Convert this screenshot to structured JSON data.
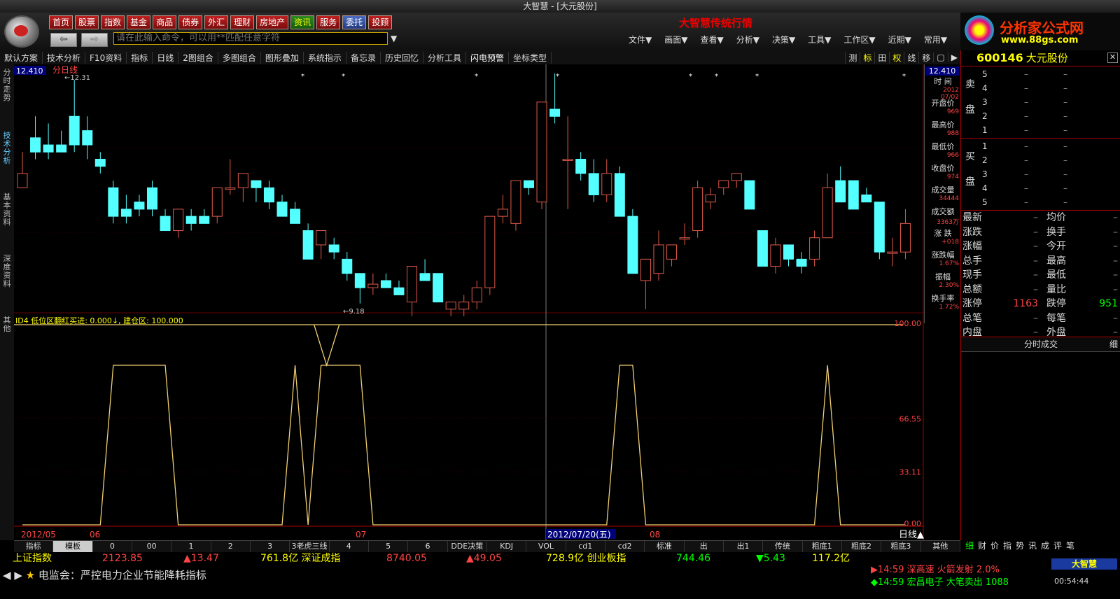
{
  "window_title": "大智慧 - [大元股份]",
  "nav": [
    "首页",
    "股票",
    "指数",
    "基金",
    "商品",
    "债券",
    "外汇",
    "理财",
    "房地产",
    "资讯",
    "服务",
    "委托",
    "投顾"
  ],
  "command_placeholder": "请在此输入命令，可以用**匹配任意字符",
  "slogan": "大智慧传统行情",
  "brand": {
    "name": "分析家公式网",
    "url": "www.88gs.com"
  },
  "menus": [
    "文件▼",
    "画面▼",
    "查看▼",
    "分析▼",
    "决策▼",
    "工具▼",
    "工作区▼",
    "近期▼",
    "常用▼"
  ],
  "toolbar": [
    "默认方案",
    "技术分析",
    "F10资料",
    "指标",
    "日线",
    "2图组合",
    "多图组合",
    "图形叠加",
    "系统指示",
    "备忘录",
    "历史回忆",
    "分析工具",
    "闪电预警",
    "坐标类型"
  ],
  "toolbar_right": [
    "测",
    "标",
    "田",
    "权",
    "线",
    "移",
    "▢",
    "▶"
  ],
  "left_tabs": [
    "分时走势",
    "技术分析",
    "基本资料",
    "深度资料",
    "其他"
  ],
  "main_chart": {
    "period_label": "分日线",
    "price_top": "12.410",
    "high_label": "12.31",
    "low_label": "9.18",
    "indicator_label": "ID4  低位区翻红买进: 0.000↓, 建仓区: 100.000",
    "indicator_axis": [
      "100.00",
      "66.55",
      "33.11",
      "0.00"
    ],
    "dates": [
      "2012/05",
      "06",
      "07",
      "2012/07/20(五)",
      "08"
    ],
    "period_button": "日线"
  },
  "chart_data": {
    "type": "candlestick",
    "candles": [
      [
        10.8,
        11.3,
        10.9,
        11.0
      ],
      [
        11.5,
        11.8,
        11.2,
        11.3
      ],
      [
        11.4,
        11.7,
        11.2,
        11.3
      ],
      [
        11.4,
        11.6,
        11.3,
        11.3
      ],
      [
        11.8,
        12.31,
        11.3,
        11.4
      ],
      [
        11.6,
        11.8,
        11.2,
        11.4
      ],
      [
        11.2,
        11.3,
        11.0,
        11.1
      ],
      [
        10.8,
        10.9,
        10.3,
        10.4
      ],
      [
        10.5,
        10.7,
        10.3,
        10.4
      ],
      [
        10.6,
        10.7,
        10.4,
        10.5
      ],
      [
        10.8,
        10.9,
        10.4,
        10.5
      ],
      [
        10.4,
        10.5,
        10.2,
        10.2
      ],
      [
        10.2,
        10.5,
        10.1,
        10.5
      ],
      [
        10.4,
        10.5,
        10.2,
        10.3
      ],
      [
        10.4,
        10.5,
        10.3,
        10.3
      ],
      [
        10.4,
        10.8,
        10.3,
        10.8
      ],
      [
        10.8,
        11.2,
        10.7,
        10.8
      ],
      [
        10.8,
        11.0,
        10.6,
        11.0
      ],
      [
        10.9,
        10.9,
        10.6,
        10.8
      ],
      [
        10.8,
        10.9,
        10.5,
        10.6
      ],
      [
        10.6,
        10.7,
        10.4,
        10.4
      ],
      [
        10.5,
        10.6,
        10.3,
        10.3
      ],
      [
        10.2,
        10.3,
        9.8,
        9.8
      ],
      [
        10.0,
        10.2,
        9.8,
        10.2
      ],
      [
        10.0,
        10.1,
        9.8,
        9.9
      ],
      [
        9.8,
        9.9,
        9.5,
        9.6
      ],
      [
        9.6,
        9.6,
        9.18,
        9.4
      ],
      [
        9.4,
        9.6,
        9.3,
        9.45
      ],
      [
        9.5,
        9.6,
        9.4,
        9.4
      ],
      [
        9.4,
        9.5,
        9.3,
        9.3
      ],
      [
        9.2,
        9.7,
        9.0,
        9.7
      ],
      [
        9.6,
        9.8,
        9.5,
        9.5
      ],
      [
        9.6,
        9.6,
        9.2,
        9.2
      ],
      [
        9.1,
        9.2,
        9.0,
        9.2
      ],
      [
        9.1,
        9.3,
        9.0,
        9.2
      ],
      [
        9.2,
        9.5,
        9.1,
        9.4
      ],
      [
        9.4,
        10.4,
        9.3,
        10.4
      ],
      [
        10.4,
        10.7,
        10.3,
        10.5
      ],
      [
        10.3,
        10.9,
        10.2,
        10.9
      ],
      [
        10.9,
        10.9,
        10.7,
        10.8
      ],
      [
        10.6,
        12.0,
        10.5,
        12.0
      ],
      [
        11.9,
        12.4,
        11.7,
        11.8
      ],
      [
        11.2,
        11.8,
        10.5,
        11.2
      ],
      [
        11.2,
        11.3,
        10.9,
        11.0
      ],
      [
        11.0,
        11.2,
        10.6,
        10.7
      ],
      [
        10.7,
        11.2,
        10.6,
        11.0
      ],
      [
        11.0,
        11.1,
        10.4,
        10.4
      ],
      [
        10.4,
        10.5,
        9.6,
        9.6
      ],
      [
        9.5,
        9.8,
        9.1,
        9.8
      ],
      [
        9.6,
        10.2,
        9.5,
        10.0
      ],
      [
        9.8,
        10.0,
        9.7,
        10.0
      ],
      [
        10.1,
        10.3,
        10.0,
        10.1
      ],
      [
        10.2,
        10.9,
        10.1,
        10.8
      ],
      [
        10.6,
        10.8,
        10.5,
        10.7
      ],
      [
        10.8,
        10.9,
        10.7,
        10.9
      ],
      [
        10.9,
        11.0,
        10.8,
        11.0
      ],
      [
        10.9,
        10.9,
        10.5,
        10.5
      ],
      [
        10.2,
        10.2,
        9.9,
        9.7
      ],
      [
        9.7,
        10.1,
        9.6,
        10.0
      ],
      [
        10.0,
        10.0,
        9.7,
        9.8
      ],
      [
        9.8,
        9.9,
        9.6,
        9.7
      ],
      [
        9.8,
        10.2,
        9.7,
        10.1
      ],
      [
        10.1,
        11.0,
        10.1,
        10.8
      ],
      [
        10.9,
        11.1,
        10.6,
        10.6
      ],
      [
        10.9,
        10.9,
        10.5,
        10.5
      ],
      [
        10.7,
        10.8,
        10.6,
        10.6
      ],
      [
        10.6,
        10.6,
        9.8,
        9.9
      ],
      [
        9.9,
        10.1,
        9.7,
        9.9
      ],
      [
        9.9,
        10.5,
        9.8,
        10.3
      ]
    ],
    "indicator": [
      0,
      0,
      0,
      0,
      0,
      0,
      0,
      100,
      100,
      100,
      100,
      100,
      0,
      0,
      0,
      0,
      0,
      0,
      0,
      0,
      0,
      100,
      0,
      100,
      100,
      100,
      100,
      0,
      0,
      0,
      0,
      0,
      0,
      0,
      0,
      0,
      0,
      0,
      0,
      0,
      0,
      0,
      0,
      0,
      0,
      0,
      100,
      100,
      0,
      0,
      0,
      0,
      0,
      0,
      0,
      0,
      0,
      0,
      0,
      0,
      0,
      0,
      100,
      0,
      0,
      0,
      0,
      0,
      0
    ]
  },
  "info_panel": [
    {
      "label": "时 间",
      "value": "2012 07/02"
    },
    {
      "label": "开盘价",
      "value": "969"
    },
    {
      "label": "最高价",
      "value": "988"
    },
    {
      "label": "最低价",
      "value": "966"
    },
    {
      "label": "收盘价",
      "value": "974"
    },
    {
      "label": "成交量",
      "value": "34444"
    },
    {
      "label": "成交额",
      "value": "3363万"
    },
    {
      "label": "涨 跌",
      "value": "+018"
    },
    {
      "label": "涨跌幅",
      "value": "1.67%"
    },
    {
      "label": "振幅",
      "value": "2.30%"
    },
    {
      "label": "换手率",
      "value": "1.72%"
    }
  ],
  "stock": {
    "code": "600146",
    "name": "大元股份"
  },
  "order_book": {
    "sell_label": [
      "卖",
      "盘"
    ],
    "buy_label": [
      "买",
      "盘"
    ],
    "sell": [
      "5",
      "4",
      "3",
      "2",
      "1"
    ],
    "buy": [
      "1",
      "2",
      "3",
      "4",
      "5"
    ],
    "dash": "–"
  },
  "stats": [
    [
      "最新",
      "–",
      "均价",
      "–"
    ],
    [
      "涨跌",
      "–",
      "换手",
      "–"
    ],
    [
      "涨幅",
      "–",
      "今开",
      "–"
    ],
    [
      "总手",
      "–",
      "最高",
      "–"
    ],
    [
      "现手",
      "–",
      "最低",
      "–"
    ],
    [
      "总额",
      "–",
      "量比",
      "–"
    ],
    [
      "涨停",
      "1163",
      "跌停",
      "951"
    ],
    [
      "总笔",
      "–",
      "每笔",
      "–"
    ],
    [
      "内盘",
      "–",
      "外盘",
      "–"
    ]
  ],
  "fs_bar": {
    "label": "分时成交",
    "x": "细"
  },
  "bottom_tabs": [
    "指标",
    "模板",
    "0",
    "00",
    "1",
    "2",
    "3",
    "3老虎三线",
    "4",
    "5",
    "6",
    "DDE决策",
    "KDJ",
    "VOL",
    "cd1",
    "cd2",
    "标准",
    "出",
    "出1",
    "传统",
    "粗底1",
    "粗底2",
    "粗底3",
    "其他"
  ],
  "right_tabs": [
    "细",
    "财",
    "价",
    "指",
    "势",
    "讯",
    "成",
    "评",
    "笔"
  ],
  "ticker": [
    {
      "t": "上证指数",
      "c": "#ff0"
    },
    {
      "t": "2123.85",
      "c": "#f44"
    },
    {
      "t": "▲13.47",
      "c": "#f44"
    },
    {
      "t": "761.8亿 深证成指",
      "c": "#ff0"
    },
    {
      "t": "8740.05",
      "c": "#f44"
    },
    {
      "t": "▲49.05",
      "c": "#f44"
    },
    {
      "t": "728.9亿 创业板指",
      "c": "#ff0"
    },
    {
      "t": "744.46",
      "c": "#0f0"
    },
    {
      "t": "▼5.43",
      "c": "#0f0"
    },
    {
      "t": "117.2亿",
      "c": "#ff0"
    }
  ],
  "news": "电监会：严控电力企业节能降耗指标",
  "alerts": [
    {
      "t": "14:59 深高速  火箭发射 2.0%",
      "c": "#f44"
    },
    {
      "t": "14:59 宏昌电子 大笔卖出 1088",
      "c": "#0f0"
    }
  ],
  "clock": "00:54:44",
  "app_brand": "大智慧"
}
